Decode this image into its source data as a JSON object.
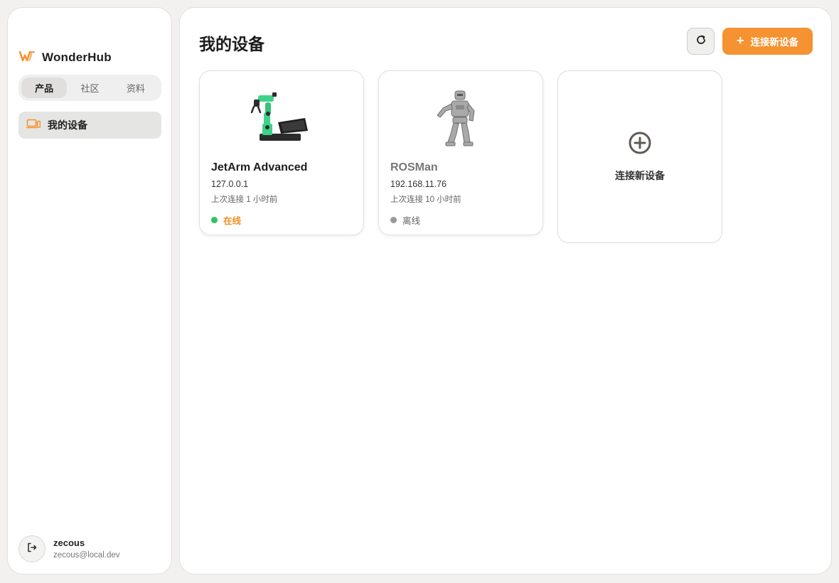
{
  "app": {
    "name": "WonderHub",
    "brand_color": "#f59231"
  },
  "sidebar": {
    "tabs": [
      {
        "label": "产品",
        "active": true
      },
      {
        "label": "社区",
        "active": false
      },
      {
        "label": "资料",
        "active": false
      }
    ],
    "nav": [
      {
        "label": "我的设备",
        "icon": "laptop-icon",
        "active": true
      }
    ],
    "user": {
      "name": "zecous",
      "email": "zecous@local.dev",
      "icon": "logout-icon"
    }
  },
  "main": {
    "title": "我的设备",
    "refresh_icon": "refresh-icon",
    "connect_button": {
      "icon": "plus-icon",
      "label": "连接新设备"
    },
    "devices": [
      {
        "name": "JetArm Advanced",
        "ip": "127.0.0.1",
        "last_connected": "上次连接 1 小时前",
        "status": "在线",
        "status_color": "#2ec45a",
        "image": "robot-arm-image"
      },
      {
        "name": "ROSMan",
        "ip": "192.168.11.76",
        "last_connected": "上次连接 10 小时前",
        "status": "离线",
        "status_color": "#9b9896",
        "image": "humanoid-robot-image"
      }
    ],
    "add_card": {
      "icon": "plus-circle-icon",
      "label": "连接新设备"
    }
  }
}
